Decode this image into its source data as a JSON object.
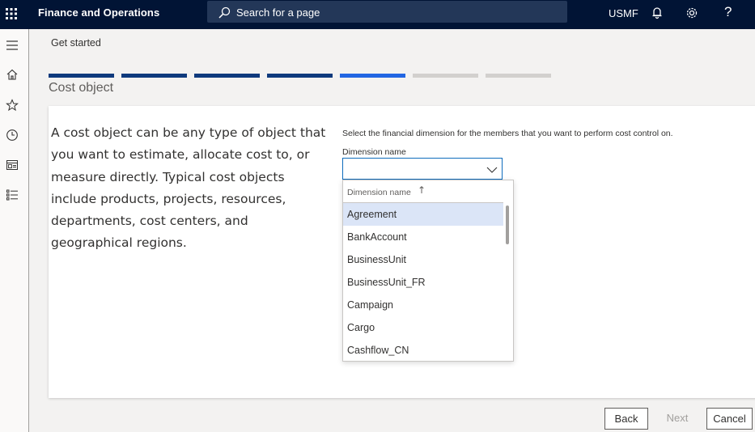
{
  "topbar": {
    "app_title": "Finance and Operations",
    "search_placeholder": "Search for a page",
    "company": "USMF",
    "help_label": "?",
    "icons": [
      "waffle-icon",
      "search-icon",
      "bell-icon",
      "gear-icon",
      "help-icon"
    ]
  },
  "leftnav": {
    "icons": [
      "hamburger-icon",
      "home-icon",
      "star-icon",
      "clock-icon",
      "workspace-icon",
      "list-icon"
    ]
  },
  "breadcrumb": "Get started",
  "wizard": {
    "total_steps": 7,
    "current_step": 5,
    "colors": {
      "done": "#0f3a7d",
      "current": "#2266e3",
      "todo": "#d2d0ce"
    }
  },
  "page_title": "Cost object",
  "description": "A cost object can be any type of object that you want to estimate, allocate cost to, or measure directly. Typical cost objects include products, projects, resources, departments, cost centers, and geographical regions.",
  "form": {
    "instruction": "Select the financial dimension for the members that you want to perform cost control on.",
    "field_label": "Dimension name",
    "field_value": ""
  },
  "dropdown": {
    "column_header": "Dimension name",
    "sort_indicator": "↑",
    "selected_index": 0,
    "items": [
      "Agreement",
      "BankAccount",
      "BusinessUnit",
      "BusinessUnit_FR",
      "Campaign",
      "Cargo",
      "Cashflow_CN"
    ]
  },
  "buttons": {
    "back": "Back",
    "next": "Next",
    "cancel": "Cancel"
  }
}
